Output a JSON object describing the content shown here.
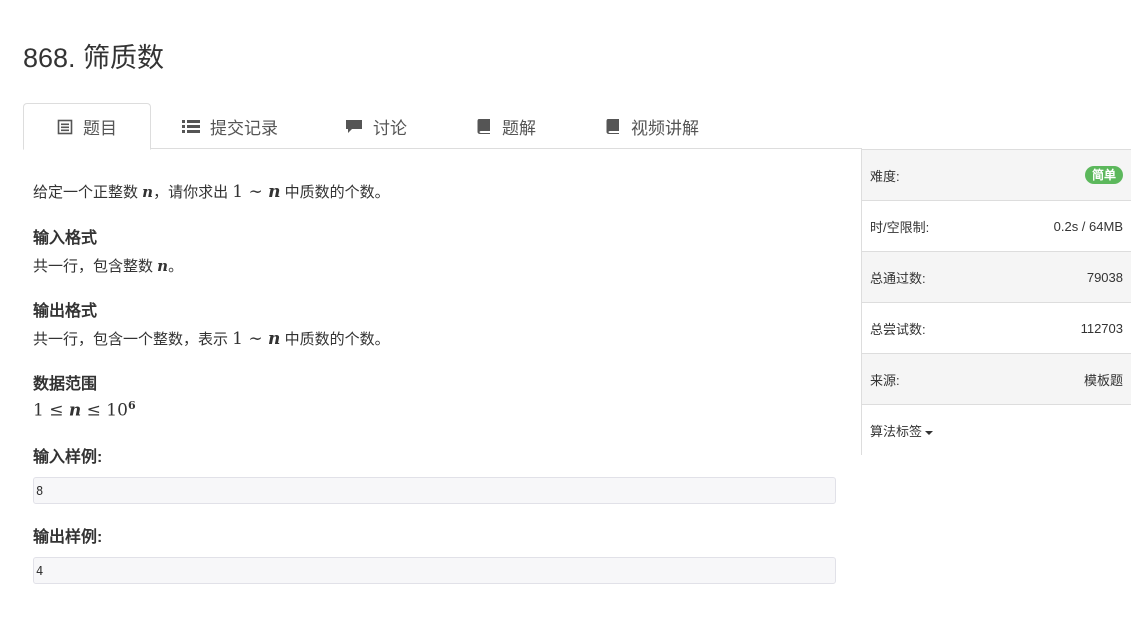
{
  "problem": {
    "title": "868. 筛质数"
  },
  "tabs": [
    {
      "label": "题目",
      "icon": "document-icon"
    },
    {
      "label": "提交记录",
      "icon": "list-icon"
    },
    {
      "label": "讨论",
      "icon": "comment-icon"
    },
    {
      "label": "题解",
      "icon": "book-icon"
    },
    {
      "label": "视频讲解",
      "icon": "book-icon"
    }
  ],
  "statement": {
    "intro_prefix": "给定一个正整数 ",
    "intro_var": "n",
    "intro_mid": "，请你求出 ",
    "intro_math_a": "1 ∼ ",
    "intro_math_b": "n",
    "intro_suffix": " 中质数的个数。",
    "input_heading": "输入格式",
    "input_prefix": "共一行，包含整数 ",
    "input_var": "n",
    "input_suffix": "。",
    "output_heading": "输出格式",
    "output_prefix": "共一行，包含一个整数，表示 ",
    "output_math_a": "1 ∼ ",
    "output_math_b": "n",
    "output_suffix": " 中质数的个数。",
    "range_heading": "数据范围",
    "range_a": "1 ≤ ",
    "range_var": "n",
    "range_b": " ≤ 10",
    "range_exp": "6",
    "sample_input_heading": "输入样例:",
    "sample_input": "8",
    "sample_output_heading": "输出样例:",
    "sample_output": "4"
  },
  "sidebar": {
    "difficulty_label": "难度:",
    "difficulty_value": "简单",
    "limit_label": "时/空限制:",
    "limit_value": "0.2s / 64MB",
    "passed_label": "总通过数:",
    "passed_value": "79038",
    "attempts_label": "总尝试数:",
    "attempts_value": "112703",
    "source_label": "来源:",
    "source_value": "模板题",
    "tags_label": "算法标签"
  },
  "colors": {
    "badge": "#5cb85c",
    "border": "#dddddd",
    "code_bg": "#f7f7f9"
  }
}
